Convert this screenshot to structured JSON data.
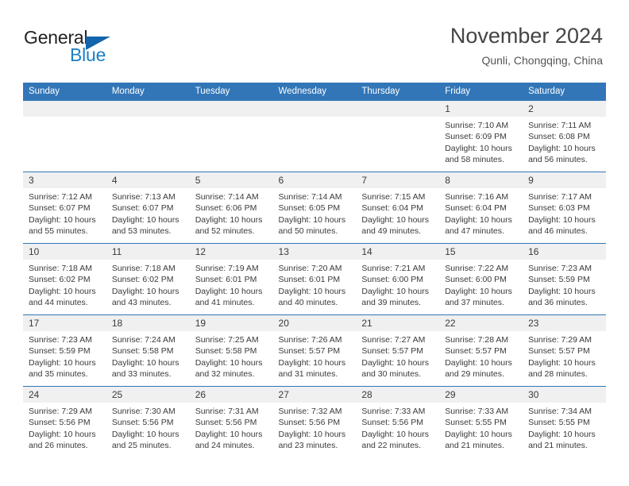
{
  "brand": {
    "name_part1": "General",
    "name_part2": "Blue",
    "triangle_color": "#1464ac",
    "blue_color": "#1b7fc4"
  },
  "header": {
    "title": "November 2024",
    "location": "Qunli, Chongqing, China"
  },
  "theme": {
    "header_blue": "#3276b8",
    "daynum_gray": "#f0f0f0",
    "text": "#3a3a3a"
  },
  "weekdays": [
    "Sunday",
    "Monday",
    "Tuesday",
    "Wednesday",
    "Thursday",
    "Friday",
    "Saturday"
  ],
  "labels": {
    "sunrise_prefix": "Sunrise:",
    "sunset_prefix": "Sunset:",
    "daylight_prefix": "Daylight:"
  },
  "weeks": [
    [
      {
        "day": "",
        "empty": true
      },
      {
        "day": "",
        "empty": true
      },
      {
        "day": "",
        "empty": true
      },
      {
        "day": "",
        "empty": true
      },
      {
        "day": "",
        "empty": true
      },
      {
        "day": "1",
        "sunrise": "Sunrise: 7:10 AM",
        "sunset": "Sunset: 6:09 PM",
        "daylight": "Daylight: 10 hours and 58 minutes."
      },
      {
        "day": "2",
        "sunrise": "Sunrise: 7:11 AM",
        "sunset": "Sunset: 6:08 PM",
        "daylight": "Daylight: 10 hours and 56 minutes."
      }
    ],
    [
      {
        "day": "3",
        "sunrise": "Sunrise: 7:12 AM",
        "sunset": "Sunset: 6:07 PM",
        "daylight": "Daylight: 10 hours and 55 minutes."
      },
      {
        "day": "4",
        "sunrise": "Sunrise: 7:13 AM",
        "sunset": "Sunset: 6:07 PM",
        "daylight": "Daylight: 10 hours and 53 minutes."
      },
      {
        "day": "5",
        "sunrise": "Sunrise: 7:14 AM",
        "sunset": "Sunset: 6:06 PM",
        "daylight": "Daylight: 10 hours and 52 minutes."
      },
      {
        "day": "6",
        "sunrise": "Sunrise: 7:14 AM",
        "sunset": "Sunset: 6:05 PM",
        "daylight": "Daylight: 10 hours and 50 minutes."
      },
      {
        "day": "7",
        "sunrise": "Sunrise: 7:15 AM",
        "sunset": "Sunset: 6:04 PM",
        "daylight": "Daylight: 10 hours and 49 minutes."
      },
      {
        "day": "8",
        "sunrise": "Sunrise: 7:16 AM",
        "sunset": "Sunset: 6:04 PM",
        "daylight": "Daylight: 10 hours and 47 minutes."
      },
      {
        "day": "9",
        "sunrise": "Sunrise: 7:17 AM",
        "sunset": "Sunset: 6:03 PM",
        "daylight": "Daylight: 10 hours and 46 minutes."
      }
    ],
    [
      {
        "day": "10",
        "sunrise": "Sunrise: 7:18 AM",
        "sunset": "Sunset: 6:02 PM",
        "daylight": "Daylight: 10 hours and 44 minutes."
      },
      {
        "day": "11",
        "sunrise": "Sunrise: 7:18 AM",
        "sunset": "Sunset: 6:02 PM",
        "daylight": "Daylight: 10 hours and 43 minutes."
      },
      {
        "day": "12",
        "sunrise": "Sunrise: 7:19 AM",
        "sunset": "Sunset: 6:01 PM",
        "daylight": "Daylight: 10 hours and 41 minutes."
      },
      {
        "day": "13",
        "sunrise": "Sunrise: 7:20 AM",
        "sunset": "Sunset: 6:01 PM",
        "daylight": "Daylight: 10 hours and 40 minutes."
      },
      {
        "day": "14",
        "sunrise": "Sunrise: 7:21 AM",
        "sunset": "Sunset: 6:00 PM",
        "daylight": "Daylight: 10 hours and 39 minutes."
      },
      {
        "day": "15",
        "sunrise": "Sunrise: 7:22 AM",
        "sunset": "Sunset: 6:00 PM",
        "daylight": "Daylight: 10 hours and 37 minutes."
      },
      {
        "day": "16",
        "sunrise": "Sunrise: 7:23 AM",
        "sunset": "Sunset: 5:59 PM",
        "daylight": "Daylight: 10 hours and 36 minutes."
      }
    ],
    [
      {
        "day": "17",
        "sunrise": "Sunrise: 7:23 AM",
        "sunset": "Sunset: 5:59 PM",
        "daylight": "Daylight: 10 hours and 35 minutes."
      },
      {
        "day": "18",
        "sunrise": "Sunrise: 7:24 AM",
        "sunset": "Sunset: 5:58 PM",
        "daylight": "Daylight: 10 hours and 33 minutes."
      },
      {
        "day": "19",
        "sunrise": "Sunrise: 7:25 AM",
        "sunset": "Sunset: 5:58 PM",
        "daylight": "Daylight: 10 hours and 32 minutes."
      },
      {
        "day": "20",
        "sunrise": "Sunrise: 7:26 AM",
        "sunset": "Sunset: 5:57 PM",
        "daylight": "Daylight: 10 hours and 31 minutes."
      },
      {
        "day": "21",
        "sunrise": "Sunrise: 7:27 AM",
        "sunset": "Sunset: 5:57 PM",
        "daylight": "Daylight: 10 hours and 30 minutes."
      },
      {
        "day": "22",
        "sunrise": "Sunrise: 7:28 AM",
        "sunset": "Sunset: 5:57 PM",
        "daylight": "Daylight: 10 hours and 29 minutes."
      },
      {
        "day": "23",
        "sunrise": "Sunrise: 7:29 AM",
        "sunset": "Sunset: 5:57 PM",
        "daylight": "Daylight: 10 hours and 28 minutes."
      }
    ],
    [
      {
        "day": "24",
        "sunrise": "Sunrise: 7:29 AM",
        "sunset": "Sunset: 5:56 PM",
        "daylight": "Daylight: 10 hours and 26 minutes."
      },
      {
        "day": "25",
        "sunrise": "Sunrise: 7:30 AM",
        "sunset": "Sunset: 5:56 PM",
        "daylight": "Daylight: 10 hours and 25 minutes."
      },
      {
        "day": "26",
        "sunrise": "Sunrise: 7:31 AM",
        "sunset": "Sunset: 5:56 PM",
        "daylight": "Daylight: 10 hours and 24 minutes."
      },
      {
        "day": "27",
        "sunrise": "Sunrise: 7:32 AM",
        "sunset": "Sunset: 5:56 PM",
        "daylight": "Daylight: 10 hours and 23 minutes."
      },
      {
        "day": "28",
        "sunrise": "Sunrise: 7:33 AM",
        "sunset": "Sunset: 5:56 PM",
        "daylight": "Daylight: 10 hours and 22 minutes."
      },
      {
        "day": "29",
        "sunrise": "Sunrise: 7:33 AM",
        "sunset": "Sunset: 5:55 PM",
        "daylight": "Daylight: 10 hours and 21 minutes."
      },
      {
        "day": "30",
        "sunrise": "Sunrise: 7:34 AM",
        "sunset": "Sunset: 5:55 PM",
        "daylight": "Daylight: 10 hours and 21 minutes."
      }
    ]
  ]
}
